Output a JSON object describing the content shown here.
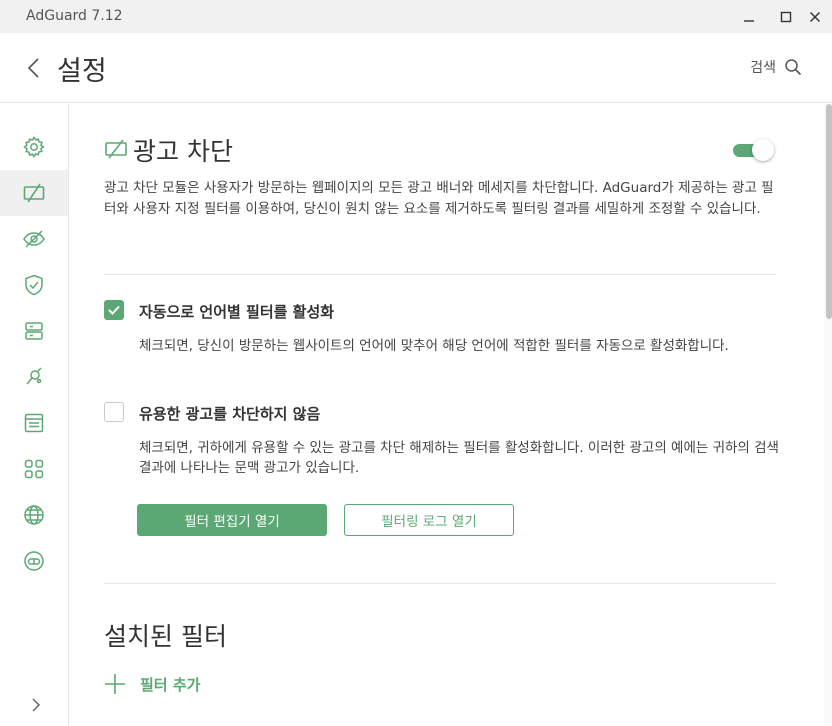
{
  "window": {
    "title": "AdGuard 7.12",
    "controls": [
      "minimize-icon",
      "maximize-icon",
      "close-icon"
    ]
  },
  "header": {
    "title": "설정",
    "back_icon": "chevron-left-icon",
    "search_label": "검색",
    "search_icon": "search-icon"
  },
  "sidebar": {
    "items": [
      {
        "icon": "gear-icon",
        "active": false
      },
      {
        "icon": "ad-block-icon",
        "active": true
      },
      {
        "icon": "eye-slash-icon",
        "active": false
      },
      {
        "icon": "shield-check-icon",
        "active": false
      },
      {
        "icon": "browsing-security-icon",
        "active": false
      },
      {
        "icon": "extensions-icon",
        "active": false
      },
      {
        "icon": "browser-window-icon",
        "active": false
      },
      {
        "icon": "apps-grid-icon",
        "active": false
      },
      {
        "icon": "globe-icon",
        "active": false
      },
      {
        "icon": "vpn-icon",
        "active": false
      }
    ],
    "expand_icon": "chevron-right-icon"
  },
  "main": {
    "section": {
      "icon": "ad-block-icon",
      "title": "광고 차단",
      "enabled": true,
      "description": "광고 차단 모듈은 사용자가 방문하는 웹페이지의 모든 광고 배너와 메세지를 차단합니다. AdGuard가 제공하는 광고 필터와 사용자 지정 필터를 이용하여, 당신이 원치 않는 요소를 제거하도록 필터링 결과를 세밀하게 조정할 수 있습니다."
    },
    "options": [
      {
        "checked": true,
        "title": "자동으로 언어별 필터를 활성화",
        "description": "체크되면, 당신이 방문하는 웹사이트의 언어에 맞추어 해당 언어에 적합한 필터를 자동으로 활성화합니다."
      },
      {
        "checked": false,
        "title": "유용한 광고를 차단하지 않음",
        "description": "체크되면, 귀하에게 유용할 수 있는 광고를 차단 해제하는 필터를 활성화합니다. 이러한 광고의 예에는 귀하의 검색 결과에 나타나는 문맥 광고가 있습니다."
      }
    ],
    "buttons": {
      "open_filter_editor": "필터 편집기 열기",
      "open_filtering_log": "필터링 로그 열기"
    },
    "installed_filters": {
      "title": "설치된 필터",
      "add_filter_label": "필터 추가",
      "add_icon": "plus-icon"
    }
  },
  "colors": {
    "accent": "#5ba875",
    "titlebar": "#f1f1f1",
    "active_nav": "#f0f0f0"
  }
}
